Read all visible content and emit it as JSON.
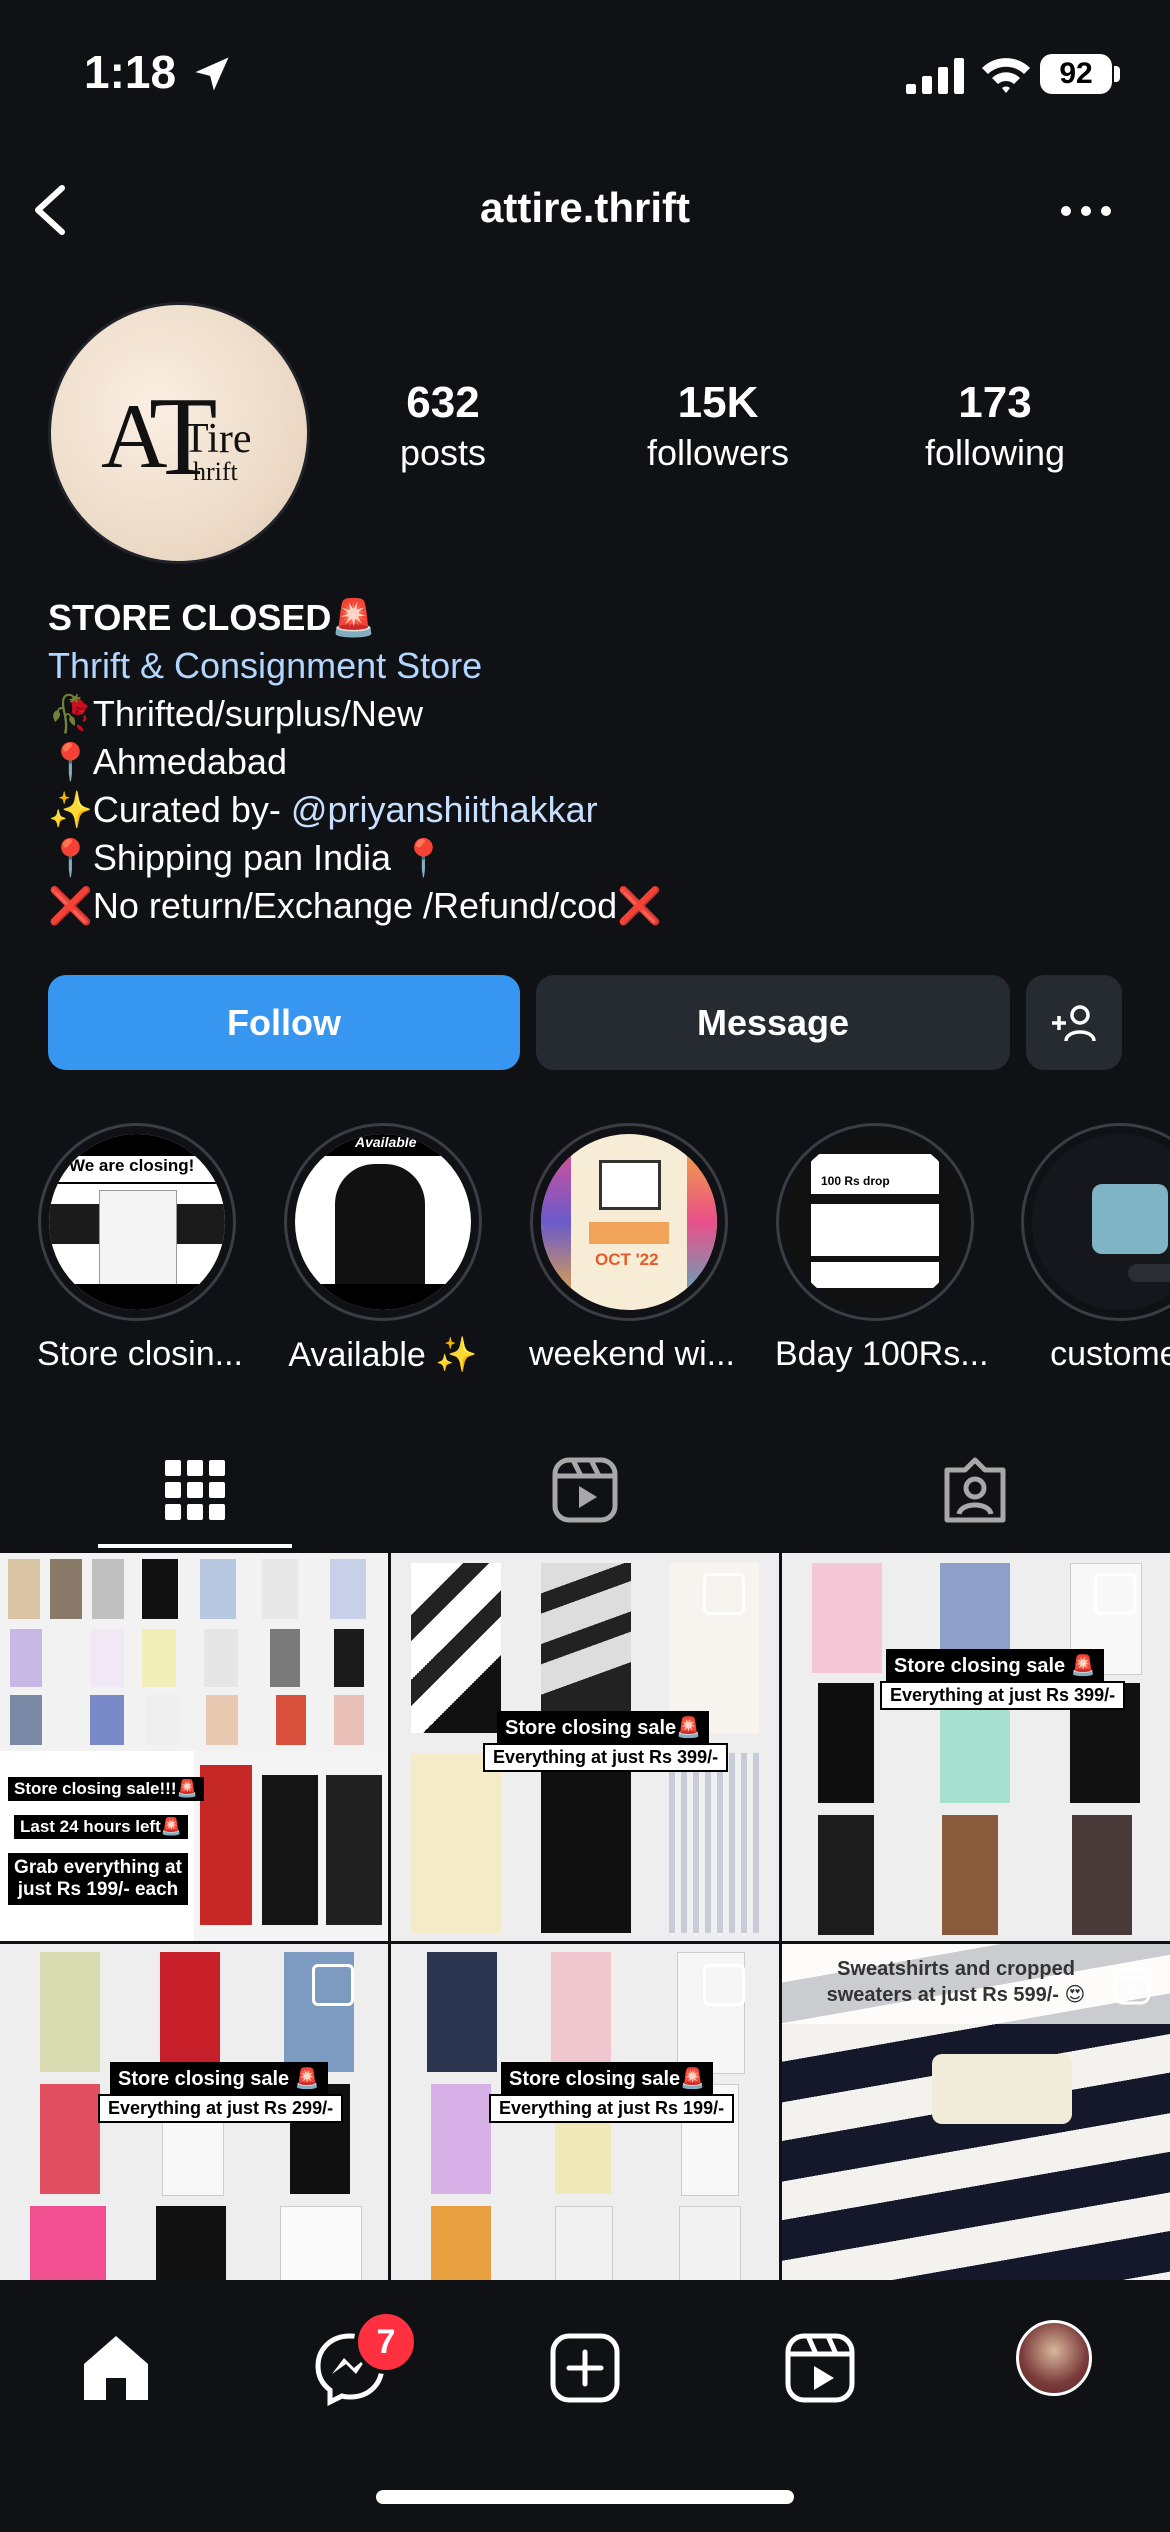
{
  "status_bar": {
    "time": "1:18",
    "battery": "92"
  },
  "header": {
    "username": "attire.thrift"
  },
  "profile": {
    "logo": {
      "a": "A",
      "t": "T",
      "tire": "Tire",
      "hrift": "hrift"
    },
    "stats": [
      {
        "value": "632",
        "label": "posts"
      },
      {
        "value": "15K",
        "label": "followers"
      },
      {
        "value": "173",
        "label": "following"
      }
    ],
    "bio": {
      "name": "STORE CLOSED🚨",
      "category": "Thrift & Consignment Store",
      "line1": "🥀Thrifted/surplus/New",
      "line2": "📍Ahmedabad",
      "line3_prefix": "✨Curated by- ",
      "line3_mention": "@priyanshiithakkar",
      "line4": "📍Shipping pan India 📍",
      "line5": "❌No return/Exchange /Refund/cod❌"
    }
  },
  "actions": {
    "follow": "Follow",
    "message": "Message"
  },
  "highlights": [
    {
      "label": "Store closin...",
      "cover_text": "We are closing!"
    },
    {
      "label": "Available ✨",
      "cover_text": "Available"
    },
    {
      "label": "weekend wi...",
      "cover_text": "OCT '22"
    },
    {
      "label": "Bday 100Rs...",
      "cover_text": "100 Rs drop"
    },
    {
      "label": "customer",
      "cover_text": ""
    }
  ],
  "tabs": [
    "grid-icon",
    "reels-icon",
    "tagged-icon"
  ],
  "posts": [
    {
      "lines": [
        "Store closing sale!!!🚨",
        "Last 24 hours left🚨",
        "Grab everything at just Rs 199/- each"
      ]
    },
    {
      "lines": [
        "Store closing sale🚨",
        "Everything at just Rs 399/-"
      ]
    },
    {
      "lines": [
        "Store closing sale 🚨",
        "Everything at just Rs 399/-"
      ]
    },
    {
      "lines": [
        "Store closing sale 🚨",
        "Everything at just Rs 299/-"
      ]
    },
    {
      "lines": [
        "Store closing sale🚨",
        "Everything at just Rs 199/-"
      ]
    },
    {
      "lines": [
        "Sweatshirts and cropped sweaters at just Rs 599/- 😍"
      ]
    }
  ],
  "bottom_nav": {
    "messages_badge": "7"
  }
}
